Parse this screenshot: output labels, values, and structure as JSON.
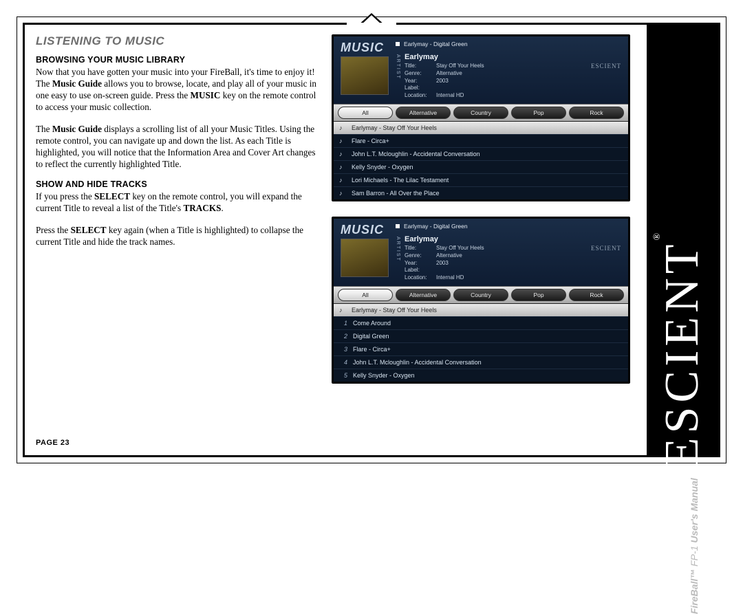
{
  "page": {
    "section_title": "LISTENING TO MUSIC",
    "page_label": "PAGE 23"
  },
  "body": {
    "h1": "BROWSING YOUR MUSIC LIBRARY",
    "p1a": "Now that you have gotten your music into your FireBall, it's time to enjoy it! The ",
    "p1b_bold": "Music Guide",
    "p1c": " allows you to browse, locate, and play all of your music in one easy to use on-screen guide. Press the ",
    "p1d_bold": "MUSIC",
    "p1e": " key on the remote control to access your music collection.",
    "p2a": "The ",
    "p2b_bold": "Music Guide",
    "p2c": " displays a scrolling list of all your Music Titles. Using the remote control, you can navigate up and down the list. As each Title is highlighted, you will notice that the Information Area and Cover Art changes to reflect the currently highlighted Title.",
    "h2": "SHOW AND HIDE TRACKS",
    "p3a": "If you press the ",
    "p3b_bold": "SELECT",
    "p3c": " key on the remote control, you will expand the current Title to reveal a list of the Title's ",
    "p3d_bold": "TRACKS",
    "p3e": ".",
    "p4a": "Press the ",
    "p4b_bold": "SELECT",
    "p4c": " key again (when a Title is highlighted) to collapse the current Title and hide the track names."
  },
  "brand": {
    "manual_pre": "FireBall™ ",
    "manual_mid": "FP-1 ",
    "manual_post": "User's Manual",
    "logo": "ESCIENT",
    "reg": "®"
  },
  "screens": {
    "title": "MUSIC",
    "nowplaying": "Earlymay - Digital Green",
    "artist": "Earlymay",
    "meta": {
      "title_k": "Title:",
      "title_v": "Stay Off Your Heels",
      "genre_k": "Genre:",
      "genre_v": "Alternative",
      "year_k": "Year:",
      "year_v": "2003",
      "label_k": "Label:",
      "label_v": "",
      "loc_k": "Location:",
      "loc_v": "Internal HD"
    },
    "artist_label": "ARTIST",
    "panel_logo": "ESCIENT",
    "tabs": [
      "All",
      "Alternative",
      "Country",
      "Pop",
      "Rock"
    ],
    "list1": [
      {
        "note": "♪",
        "text": "Earlymay - Stay Off Your Heels",
        "selected": true
      },
      {
        "note": "♪",
        "text": "Flare - Circa+"
      },
      {
        "note": "♪",
        "text": "John L.T. Mcloughlin - Accidental Conversation"
      },
      {
        "note": "♪",
        "text": "Kelly Snyder - Oxygen"
      },
      {
        "note": "♪",
        "text": "Lori Michaels - The Lilac Testament"
      },
      {
        "note": "♪",
        "text": "Sam Barron - All Over the Place"
      }
    ],
    "list2": [
      {
        "note": "♪",
        "text": "Earlymay - Stay Off Your Heels",
        "selected": true
      },
      {
        "num": "1",
        "text": "Come Around"
      },
      {
        "num": "2",
        "text": "Digital Green"
      },
      {
        "num": "3",
        "text": "Flare - Circa+"
      },
      {
        "num": "4",
        "text": "John L.T. Mcloughlin - Accidental Conversation"
      },
      {
        "num": "5",
        "text": "Kelly Snyder - Oxygen"
      }
    ]
  }
}
